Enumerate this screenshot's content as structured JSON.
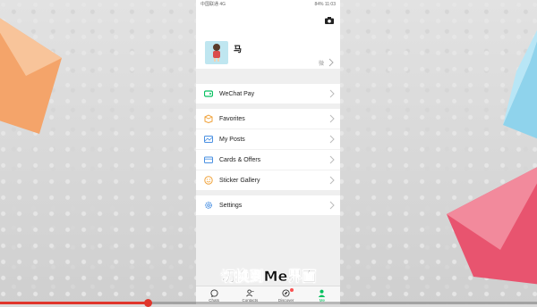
{
  "statusbar": {
    "left": "中国联通 4G",
    "right": "84% 11:03"
  },
  "profile": {
    "name": "马",
    "qr_label": "微"
  },
  "menu": {
    "pay": "WeChat Pay",
    "favorites": "Favorites",
    "posts": "My Posts",
    "cards": "Cards & Offers",
    "stickers": "Sticker Gallery",
    "settings": "Settings"
  },
  "tabs": [
    {
      "label": "Chats"
    },
    {
      "label": "Contacts"
    },
    {
      "label": "Discover"
    },
    {
      "label": "Me"
    }
  ],
  "caption": "切换到Me界面",
  "colors": {
    "accent": "#07c160",
    "badge": "#fa5151",
    "progress": "#e0362c"
  },
  "video": {
    "progress_fraction": 0.275
  }
}
